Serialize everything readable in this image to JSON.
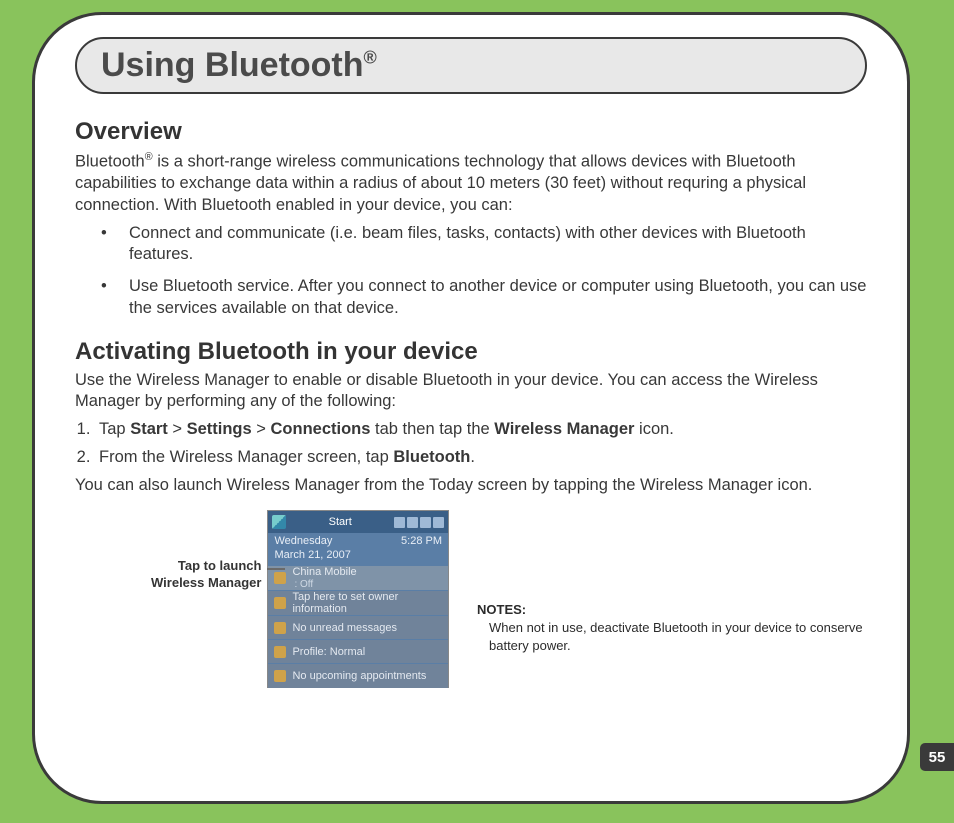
{
  "page_number": "55",
  "title_main": "Using Bluetooth",
  "title_reg": "®",
  "overview": {
    "heading": "Overview",
    "intro_a": "Bluetooth",
    "intro_sup": "®",
    "intro_b": " is a short-range wireless communications technology that allows devices with Bluetooth capabilities to exchange data within a radius of about 10 meters (30 feet) without requring a physical connection. With Bluetooth enabled in your device, you can:",
    "bullets": [
      "Connect and communicate (i.e. beam files, tasks, contacts) with other devices with Bluetooth features.",
      "Use Bluetooth service. After you connect to another device or computer using Bluetooth, you can use the services available on that device."
    ]
  },
  "activate": {
    "heading": "Activating Bluetooth in your device",
    "intro": "Use the Wireless Manager to enable or disable Bluetooth in your device. You can access the Wireless Manager by performing any of the following:",
    "step1": {
      "pre": "Tap ",
      "b1": "Start",
      "sep1": " > ",
      "b2": "Settings",
      "sep2": " > ",
      "b3": "Connections",
      "mid": " tab then tap the ",
      "b4": "Wireless Manager",
      "post": " icon."
    },
    "step2": {
      "pre": "From the Wireless Manager screen, tap ",
      "b1": "Bluetooth",
      "post": "."
    },
    "after": "You can also launch Wireless Manager from the Today screen by tapping the Wireless Manager icon."
  },
  "callout": {
    "line1": "Tap to launch",
    "line2": "Wireless Manager"
  },
  "screenshot": {
    "start_label": "Start",
    "time": "5:28 PM",
    "day": "Wednesday",
    "date": "March 21, 2007",
    "carrier": "China Mobile",
    "carrier_sub": "  : Off",
    "items": [
      "Tap here to set owner information",
      "No unread messages",
      "Profile: Normal",
      "No upcoming appointments"
    ]
  },
  "notes": {
    "label": "NOTES:",
    "body": "When not in use, deactivate Bluetooth in your device to conserve battery power."
  }
}
